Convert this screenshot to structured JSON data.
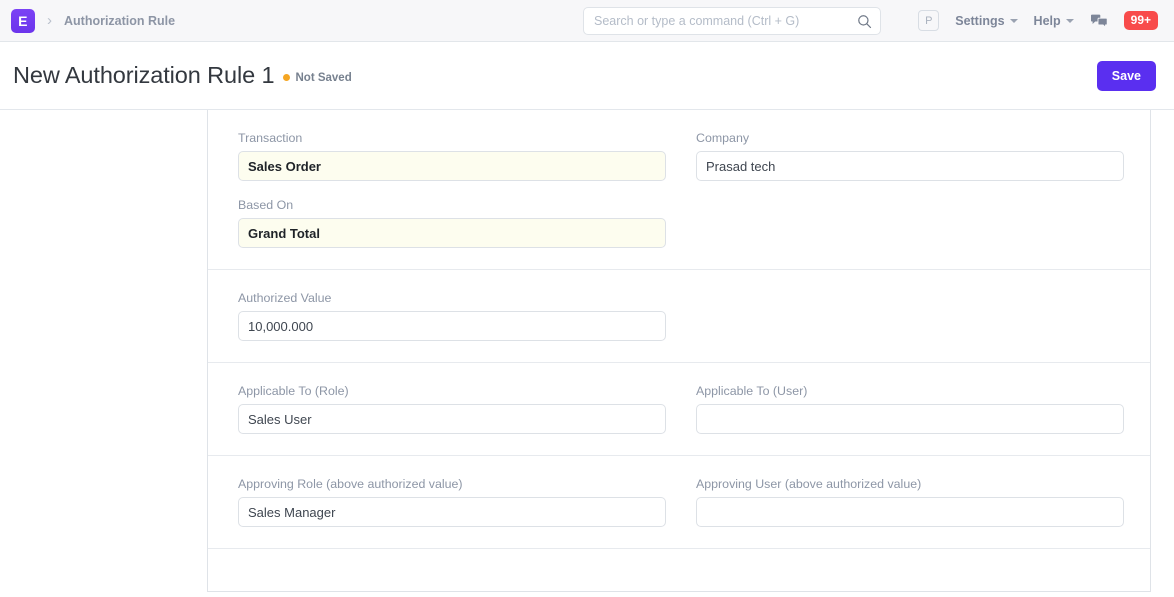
{
  "navbar": {
    "logo_letter": "E",
    "breadcrumb": "Authorization Rule",
    "search_placeholder": "Search or type a command (Ctrl + G)",
    "search_value": "",
    "avatar_letter": "P",
    "settings_label": "Settings",
    "help_label": "Help",
    "notification_count": "99+"
  },
  "page_head": {
    "title": "New Authorization Rule 1",
    "status_label": "Not Saved",
    "status_color": "#f5a623",
    "save_label": "Save"
  },
  "form": {
    "sections": [
      {
        "left_fields": [
          {
            "label": "Transaction",
            "value": "Sales Order",
            "mandatory": true,
            "placeholder": ""
          },
          {
            "label": "Based On",
            "value": "Grand Total",
            "mandatory": true,
            "placeholder": ""
          }
        ],
        "right_fields": [
          {
            "label": "Company",
            "value": "Prasad tech",
            "mandatory": false,
            "placeholder": ""
          }
        ]
      },
      {
        "left_fields": [
          {
            "label": "Authorized Value",
            "value": "10,000.000",
            "mandatory": false,
            "placeholder": ""
          }
        ],
        "right_fields": []
      },
      {
        "left_fields": [
          {
            "label": "Applicable To (Role)",
            "value": "Sales User",
            "mandatory": false,
            "placeholder": ""
          }
        ],
        "right_fields": [
          {
            "label": "Applicable To (User)",
            "value": "",
            "mandatory": false,
            "placeholder": ""
          }
        ]
      },
      {
        "left_fields": [
          {
            "label": "Approving Role (above authorized value)",
            "value": "Sales Manager",
            "mandatory": false,
            "placeholder": ""
          }
        ],
        "right_fields": [
          {
            "label": "Approving User (above authorized value)",
            "value": "",
            "mandatory": false,
            "placeholder": ""
          }
        ]
      }
    ]
  },
  "colors": {
    "brand_purple": "#7c3aed",
    "save_purple": "#5a2ff0",
    "badge_red": "#f84b4b",
    "mandatory_bg": "#fdfdef",
    "label_gray": "#8d96a6"
  }
}
